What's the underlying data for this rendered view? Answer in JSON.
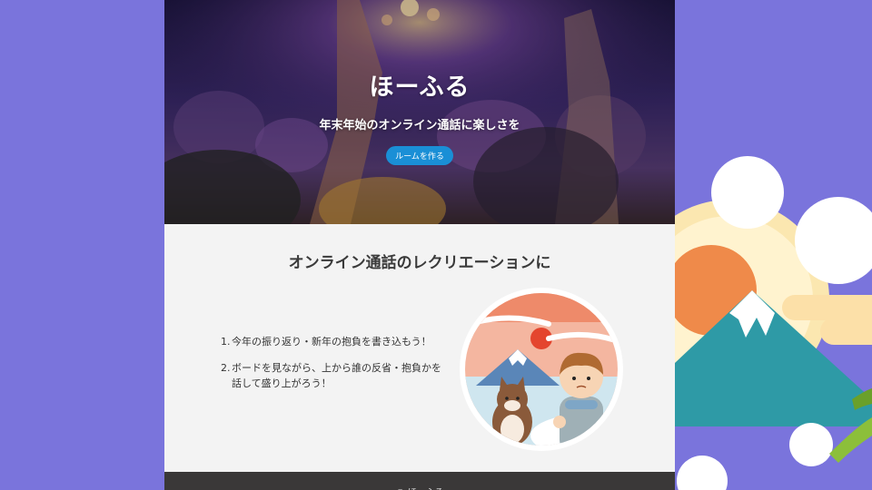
{
  "hero": {
    "title": "ほーふる",
    "subtitle": "年末年始のオンライン通話に楽しさを",
    "cta_label": "ルームを作る"
  },
  "section": {
    "title": "オンライン通話のレクリエーションに",
    "steps": [
      {
        "num": "1.",
        "text": "今年の振り返り・新年の抱負を書き込もう！"
      },
      {
        "num": "2.",
        "text": "ボードを見ながら、上から誰の反省・抱負かを話して盛り上がろう！"
      }
    ]
  },
  "footer": {
    "text": "© ほーふる"
  },
  "colors": {
    "page_bg": "#7a74dc",
    "cta": "#1a8fd6",
    "footer": "#3a3838"
  }
}
